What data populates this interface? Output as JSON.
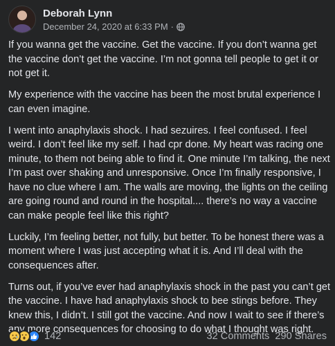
{
  "post": {
    "author": "Deborah Lynn",
    "timestamp": "December 24, 2020 at 6:33 PM",
    "separator": "·",
    "privacy_icon": "globe-icon",
    "paragraphs": [
      "If you wanna get the vaccine. Get the vaccine. If you don’t wanna get the vaccine don’t get the vaccine. I’m not gonna tell people to get it or not get it.",
      "My experience with the vaccine has been the most brutal experience I can even imagine.",
      "I went into anaphylaxis shock. I had sezuires. I feel confused. I feel weird. I don’t feel like my self. I had cpr done. My heart was racing one minute, to them not being able to find it. One minute I’m talking, the next I’m past over shaking and unresponsive. Once I’m finally responsive, I have no clue where I am. The walls are moving, the lights on the ceiling are going round and round in the hospital.... there’s no way a vaccine can make people feel like this right?",
      "Luckily, I’m feeling better, not fully, but better. To be honest there was a moment where I was just accepting what it is. And I’ll deal with the consequences after.",
      "Turns out, if you’ve ever had anaphylaxis shock in the past you can’t get the vaccine. I have had anaphylaxis shock to bee stings before. They knew this, I didn’t. I still got the vaccine. And now I wait to see if there’s any more consequences for choosing to do what I thought was right."
    ]
  },
  "footer": {
    "reactions": [
      "sad-reaction-icon",
      "wow-reaction-icon",
      "like-reaction-icon"
    ],
    "reaction_count": "142",
    "comments": "32 Comments",
    "shares": "290 Shares"
  },
  "colors": {
    "background": "#242526",
    "primary_text": "#e4e6eb",
    "secondary_text": "#b0b3b8",
    "like_blue": "#2d88ff",
    "emoji_yellow": "#f7c84a"
  }
}
